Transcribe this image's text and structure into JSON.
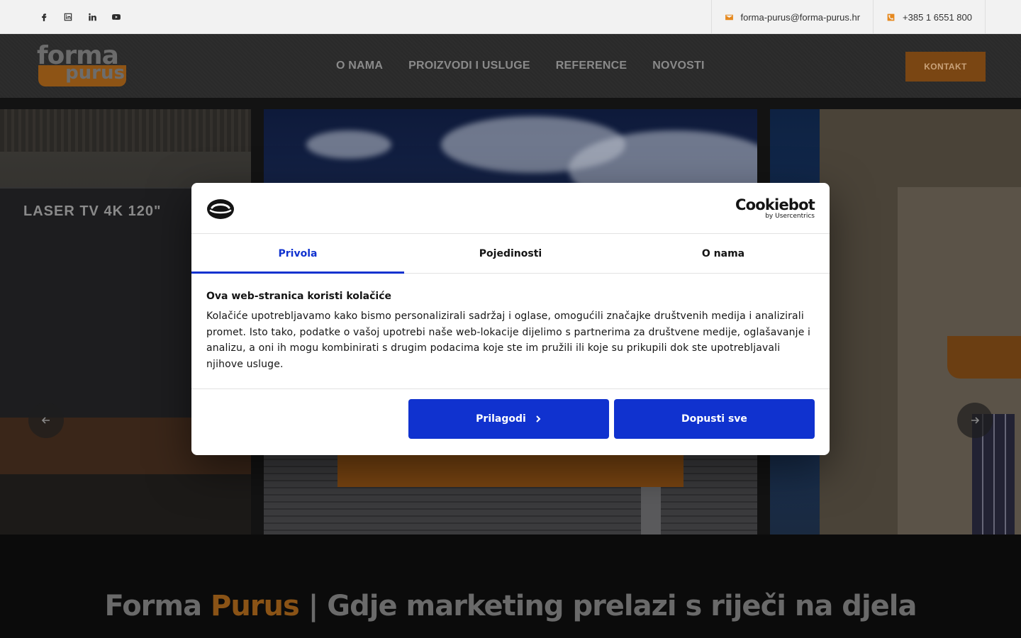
{
  "topbar": {
    "email": "forma-purus@forma-purus.hr",
    "phone": "+385 1 6551 800",
    "social_icons": [
      "facebook-icon",
      "linkedin-square-icon",
      "linkedin-icon",
      "youtube-icon"
    ]
  },
  "header": {
    "logo_word1": "forma",
    "logo_word2": "purus",
    "nav": [
      "O NAMA",
      "PROIZVODI I USLUGE",
      "REFERENCE",
      "NOVOSTI"
    ],
    "cta": "KONTAKT"
  },
  "slider": {
    "left_slide_text": "LASER TV 4K  120\""
  },
  "headline": {
    "part1": "Forma ",
    "accent": "Purus",
    "part2": " | Gdje marketing prelazi s riječi na djela"
  },
  "cookie_dialog": {
    "brand": "Cookiebot",
    "brand_sub": "by Usercentrics",
    "tabs": [
      "Privola",
      "Pojedinosti",
      "O nama"
    ],
    "active_tab": "Privola",
    "title": "Ova web-stranica koristi kolačiće",
    "body": "Kolačiće upotrebljavamo kako bismo personalizirali sadržaj i oglase, omogućili značajke društvenih medija i analizirali promet. Isto tako, podatke o vašoj upotrebi naše web-lokacije dijelimo s partnerima za društvene medije, oglašavanje i analizu, a oni ih mogu kombinirati s drugim podacima koje ste im pružili ili koje su prikupili dok ste upotrebljavali njihove usluge.",
    "btn_customize": "Prilagodi",
    "btn_allow": "Dopusti sve"
  },
  "colors": {
    "accent_orange": "#e6891f",
    "dialog_blue": "#1032cf"
  }
}
